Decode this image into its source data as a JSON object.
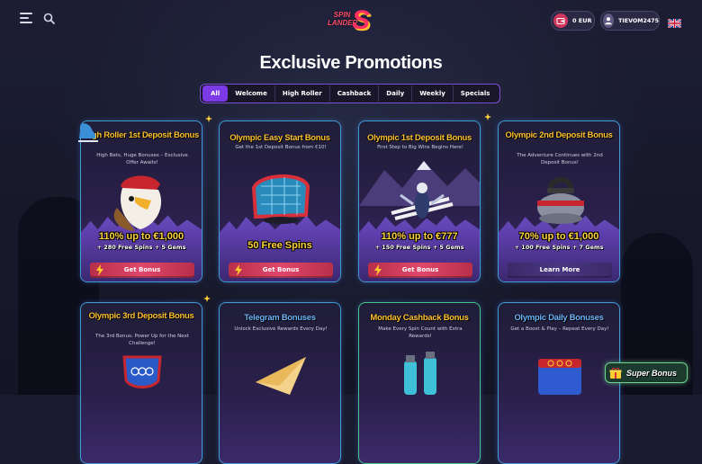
{
  "header": {
    "logo_line1": "SPIN",
    "logo_line2": "LANDER",
    "logo_mark": "S",
    "wallet_balance": "0 EUR",
    "username": "TIEVOM2475",
    "icons": [
      "menu-icon",
      "search-icon",
      "wallet-icon",
      "user-icon",
      "uk-flag-icon"
    ]
  },
  "page": {
    "title": "Exclusive Promotions"
  },
  "tabs": [
    {
      "label": "All",
      "active": true
    },
    {
      "label": "Welcome",
      "active": false
    },
    {
      "label": "High Roller",
      "active": false
    },
    {
      "label": "Cashback",
      "active": false
    },
    {
      "label": "Daily",
      "active": false
    },
    {
      "label": "Weekly",
      "active": false
    },
    {
      "label": "Specials",
      "active": false
    }
  ],
  "cards": [
    {
      "title": "High Roller 1st Deposit Bonus",
      "subtitle": "High Bets, Huge Bonuses – Exclusive Offer Awaits!",
      "offer": "110% up to €1,000",
      "offer_extra": "+ 280 Free Spins + 5 Gems",
      "cta": "Get Bonus",
      "art": "eagle-hockey-icon"
    },
    {
      "title": "Olympic Easy Start Bonus",
      "subtitle": "Get the 1st Deposit Bonus from €10!",
      "offer": "50 Free Spins",
      "offer_extra": "",
      "cta": "Get Bonus",
      "art": "hockey-goal-icon"
    },
    {
      "title": "Olympic 1st Deposit Bonus",
      "subtitle": "First Step to Big Wins Begins Here!",
      "offer": "110% up to €777",
      "offer_extra": "+ 150 Free Spins + 5 Gems",
      "cta": "Get Bonus",
      "art": "ski-jumper-icon"
    },
    {
      "title": "Olympic 2nd Deposit Bonus",
      "subtitle": "The Adventure Continues with 2nd Deposit Bonus!",
      "offer": "70% up to €1,000",
      "offer_extra": "+ 100 Free Spins + 7 Gems",
      "cta": "Learn More",
      "art": "curling-stone-icon"
    },
    {
      "title": "Olympic 3rd Deposit Bonus",
      "subtitle": "The 3rd Bonus: Power Up for the Next Challenge!",
      "art": "olympic-shield-icon"
    },
    {
      "title": "Telegram Bonuses",
      "subtitle": "Unlock Exclusive Rewards Every Day!",
      "art": "paper-plane-icon"
    },
    {
      "title": "Monday Cashback Bonus",
      "subtitle": "Make Every Spin Count with Extra Rewards!",
      "art": "flask-icon"
    },
    {
      "title": "Olympic Daily Bonuses",
      "subtitle": "Get a Boost & Play – Repeat Every Day!",
      "art": "olympic-calendar-icon"
    }
  ],
  "super_bonus": {
    "label": "Super Bonus"
  },
  "colors": {
    "accent": "#7b3ae6",
    "title_gold": "#ffc233",
    "cta_red": "#e0476a",
    "card_border": "#3f9ad6"
  }
}
